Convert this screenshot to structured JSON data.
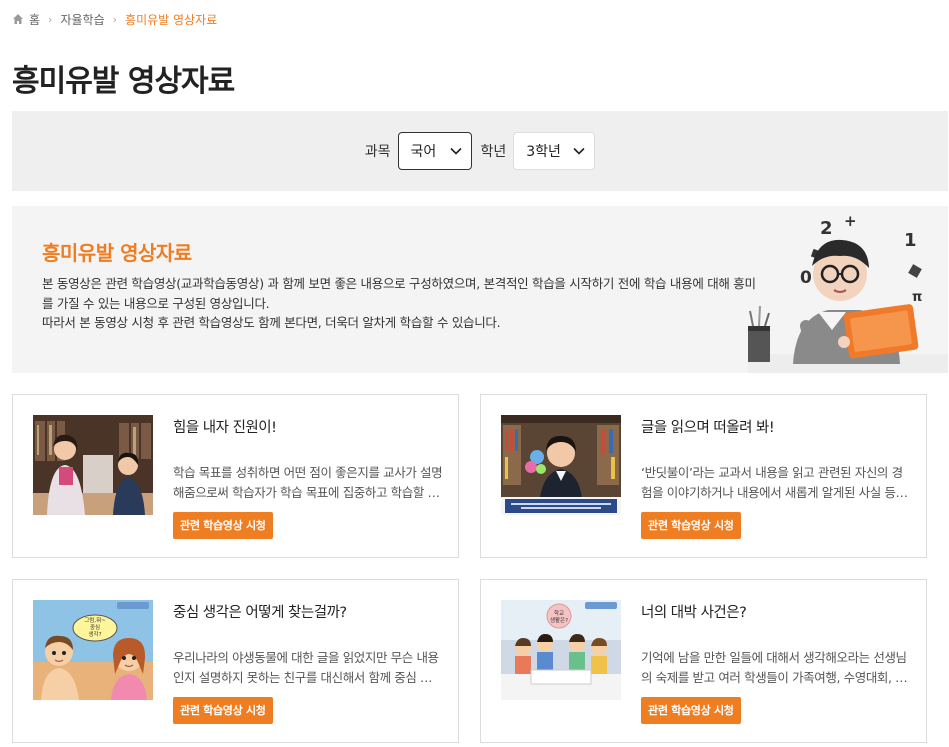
{
  "breadcrumb": {
    "home": "홈",
    "level1": "자율학습",
    "current": "흥미유발 영상자료"
  },
  "page_title": "흥미유발 영상자료",
  "filters": {
    "subject_label": "과목",
    "subject_value": "국어",
    "grade_label": "학년",
    "grade_value": "3학년"
  },
  "intro": {
    "title": "흥미유발 영상자료",
    "line1": "본 동영상은 관련 학습영상(교과학습동영상) 과 함께 보면 좋은 내용으로 구성하였으며, 본격적인 학습을 시작하기 전에 학습 내용에 대해 흥미를 가질 수 있는 내용으로 구성된 영상입니다.",
    "line2": "따라서 본 동영상 시청 후 관련 학습영상도 함께 본다면, 더욱더 알차게 학습할 수 있습니다."
  },
  "cards": [
    {
      "title": "힘을 내자 진원이!",
      "desc": "학습 목표를 성취하면 어떤 점이 좋은지를 교사가 설명해줌으로써 학습자가 학습 목표에 집중하고 학습할 수 있도록 도와줍니다.",
      "button": "관련 학습영상 시청"
    },
    {
      "title": "글을 읽으며 떠올려 봐!",
      "desc": "‘반딧불이’라는 교과서 내용을 읽고 관련된 자신의 경험을 이야기하거나 내용에서 새롭게 알게된 사실 등을 말해 봅니다.",
      "button": "관련 학습영상 시청"
    },
    {
      "title": "중심 생각은 어떻게 찾는걸까?",
      "desc": "우리나라의 야생동물에 대한 글을 읽었지만 무슨 내용인지 설명하지 못하는 친구를 대신해서 함께 중심 생각을 찾아봅니다.",
      "button": "관련 학습영상 시청"
    },
    {
      "title": "너의 대박 사건은?",
      "desc": "기억에 남을 만한 일들에 대해서 생각해오라는 선생님의 숙제를 받고 여러 학생들이 가족여행, 수영대회, 생일 등을 이야기합니다.",
      "button": "관련 학습영상 시청"
    }
  ],
  "thumb_text": {
    "card3_bubble": "그럼,뭐~\n중심\n생각?",
    "card4_bubble": "학교\n생활은?"
  },
  "colors": {
    "accent": "#ef7d22",
    "filter_bg": "#efefef",
    "intro_bg": "#f4f4f4"
  }
}
